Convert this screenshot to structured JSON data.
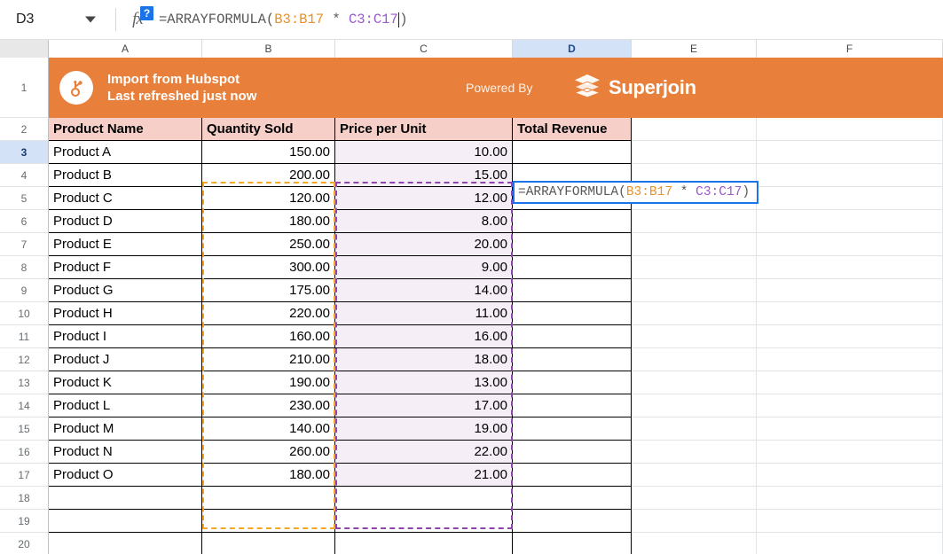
{
  "formula_bar": {
    "name_box_value": "D3",
    "name_box_dropdown": "chevron-down-icon",
    "fx_label": "fx",
    "fx_badge": "?",
    "formula_prefix": "=ARRAYFORMULA(",
    "formula_range_1": "B3:B17",
    "formula_operator": " * ",
    "formula_range_2": "C3:C17",
    "formula_suffix": ")",
    "full_formula": "=ARRAYFORMULA(B3:B17 * C3:C17)"
  },
  "columns": [
    {
      "label": "A"
    },
    {
      "label": "B"
    },
    {
      "label": "C"
    },
    {
      "label": "D",
      "selected": true
    },
    {
      "label": "E"
    },
    {
      "label": "F"
    }
  ],
  "row_numbers": [
    "1",
    "2",
    "3",
    "4",
    "5",
    "6",
    "7",
    "8",
    "9",
    "10",
    "11",
    "12",
    "13",
    "14",
    "15",
    "16",
    "17",
    "18",
    "19",
    "20"
  ],
  "selected_row": "3",
  "banner": {
    "icon": "hubspot-logo-icon",
    "title": "Import from Hubspot",
    "subtitle": "Last refreshed just now",
    "powered_by": "Powered By",
    "brand_icon": "superjoin-layers-icon",
    "brand_name": "Superjoin",
    "background_color": "#e8803c"
  },
  "table": {
    "headers": [
      "Product Name",
      "Quantity Sold",
      "Price per Unit",
      "Total Revenue"
    ],
    "header_background": "#f6cfc8",
    "rows": [
      {
        "name": "Product A",
        "qty": "150.00",
        "price": "10.00",
        "revenue": ""
      },
      {
        "name": "Product B",
        "qty": "200.00",
        "price": "15.00",
        "revenue": ""
      },
      {
        "name": "Product C",
        "qty": "120.00",
        "price": "12.00",
        "revenue": ""
      },
      {
        "name": "Product D",
        "qty": "180.00",
        "price": "8.00",
        "revenue": ""
      },
      {
        "name": "Product E",
        "qty": "250.00",
        "price": "20.00",
        "revenue": ""
      },
      {
        "name": "Product F",
        "qty": "300.00",
        "price": "9.00",
        "revenue": ""
      },
      {
        "name": "Product G",
        "qty": "175.00",
        "price": "14.00",
        "revenue": ""
      },
      {
        "name": "Product H",
        "qty": "220.00",
        "price": "11.00",
        "revenue": ""
      },
      {
        "name": "Product I",
        "qty": "160.00",
        "price": "16.00",
        "revenue": ""
      },
      {
        "name": "Product J",
        "qty": "210.00",
        "price": "18.00",
        "revenue": ""
      },
      {
        "name": "Product K",
        "qty": "190.00",
        "price": "13.00",
        "revenue": ""
      },
      {
        "name": "Product L",
        "qty": "230.00",
        "price": "17.00",
        "revenue": ""
      },
      {
        "name": "Product M",
        "qty": "140.00",
        "price": "19.00",
        "revenue": ""
      },
      {
        "name": "Product N",
        "qty": "260.00",
        "price": "22.00",
        "revenue": ""
      },
      {
        "name": "Product O",
        "qty": "180.00",
        "price": "21.00",
        "revenue": ""
      }
    ]
  },
  "cell_editor": {
    "active_cell": "D3",
    "prefix": "=ARRAYFORMULA(",
    "range_1": "B3:B17",
    "operator": " * ",
    "range_2": "C3:C17",
    "suffix": ")"
  },
  "range_highlights": {
    "b_range_color": "#f5a623",
    "c_range_color": "#8e44ad",
    "c_range_fill": "#f6eef6"
  }
}
